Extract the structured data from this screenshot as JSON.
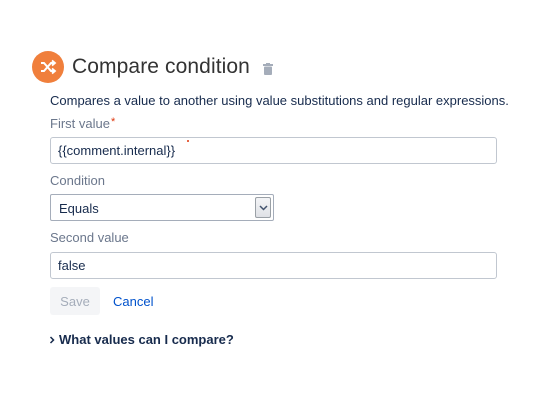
{
  "header": {
    "title": "Compare condition",
    "icon": "shuffle-icon",
    "icon_color": "#f07f3c",
    "delete_icon": "trash-icon"
  },
  "description": "Compares a value to another using value substitutions and regular expressions.",
  "fields": {
    "first_value": {
      "label": "First value",
      "required_marker": "*",
      "value": "{{comment.internal}}"
    },
    "condition": {
      "label": "Condition",
      "value": "Equals"
    },
    "second_value": {
      "label": "Second value",
      "value": "false"
    }
  },
  "actions": {
    "save_label": "Save",
    "cancel_label": "Cancel"
  },
  "help": {
    "label": "What values can I compare?"
  },
  "colors": {
    "link": "#0052cc",
    "required": "#de350b",
    "accent": "#f07f3c"
  }
}
